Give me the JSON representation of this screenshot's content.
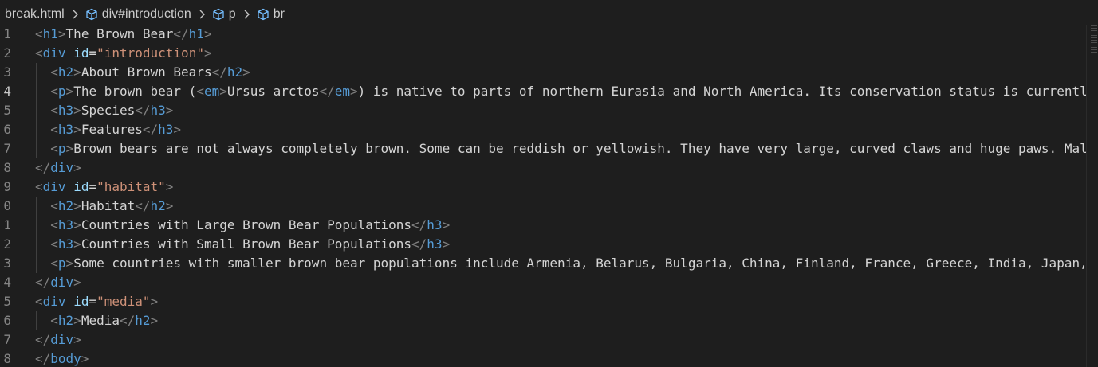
{
  "breadcrumb": {
    "file": "break.html",
    "items": [
      "div#introduction",
      "p",
      "br"
    ]
  },
  "editor": {
    "active_line": 4,
    "lines": [
      {
        "n": "1",
        "tokens": [
          [
            "t",
            "<"
          ],
          [
            "tag",
            "h1"
          ],
          [
            "t",
            ">"
          ],
          [
            "txt",
            "The Brown Bear"
          ],
          [
            "t",
            "</"
          ],
          [
            "tag",
            "h1"
          ],
          [
            "t",
            ">"
          ]
        ]
      },
      {
        "n": "2",
        "tokens": [
          [
            "t",
            "<"
          ],
          [
            "tag",
            "div"
          ],
          [
            "txt",
            " "
          ],
          [
            "attr",
            "id"
          ],
          [
            "txt",
            "="
          ],
          [
            "str",
            "\"introduction\""
          ],
          [
            "t",
            ">"
          ]
        ]
      },
      {
        "n": "3",
        "tokens": [
          [
            "txt",
            "  "
          ],
          [
            "t",
            "<"
          ],
          [
            "tag",
            "h2"
          ],
          [
            "t",
            ">"
          ],
          [
            "txt",
            "About Brown Bears"
          ],
          [
            "t",
            "</"
          ],
          [
            "tag",
            "h2"
          ],
          [
            "t",
            ">"
          ]
        ]
      },
      {
        "n": "4",
        "tokens": [
          [
            "txt",
            "  "
          ],
          [
            "t",
            "<"
          ],
          [
            "tag",
            "p"
          ],
          [
            "t",
            ">"
          ],
          [
            "txt",
            "The brown bear ("
          ],
          [
            "t",
            "<"
          ],
          [
            "tag",
            "em"
          ],
          [
            "t",
            ">"
          ],
          [
            "txt",
            "Ursus arctos"
          ],
          [
            "t",
            "</"
          ],
          [
            "tag",
            "em"
          ],
          [
            "t",
            ">"
          ],
          [
            "txt",
            ") is native to parts of northern Eurasia and North America. Its conservation status is currentl"
          ]
        ]
      },
      {
        "n": "5",
        "tokens": [
          [
            "txt",
            "  "
          ],
          [
            "t",
            "<"
          ],
          [
            "tag",
            "h3"
          ],
          [
            "t",
            ">"
          ],
          [
            "txt",
            "Species"
          ],
          [
            "t",
            "</"
          ],
          [
            "tag",
            "h3"
          ],
          [
            "t",
            ">"
          ]
        ]
      },
      {
        "n": "6",
        "tokens": [
          [
            "txt",
            "  "
          ],
          [
            "t",
            "<"
          ],
          [
            "tag",
            "h3"
          ],
          [
            "t",
            ">"
          ],
          [
            "txt",
            "Features"
          ],
          [
            "t",
            "</"
          ],
          [
            "tag",
            "h3"
          ],
          [
            "t",
            ">"
          ]
        ]
      },
      {
        "n": "7",
        "tokens": [
          [
            "txt",
            "  "
          ],
          [
            "t",
            "<"
          ],
          [
            "tag",
            "p"
          ],
          [
            "t",
            ">"
          ],
          [
            "txt",
            "Brown bears are not always completely brown. Some can be reddish or yellowish. They have very large, curved claws and huge paws. Mal"
          ]
        ]
      },
      {
        "n": "8",
        "tokens": [
          [
            "t",
            "</"
          ],
          [
            "tag",
            "div"
          ],
          [
            "t",
            ">"
          ]
        ]
      },
      {
        "n": "9",
        "tokens": [
          [
            "t",
            "<"
          ],
          [
            "tag",
            "div"
          ],
          [
            "txt",
            " "
          ],
          [
            "attr",
            "id"
          ],
          [
            "txt",
            "="
          ],
          [
            "str",
            "\"habitat\""
          ],
          [
            "t",
            ">"
          ]
        ]
      },
      {
        "n": "0",
        "tokens": [
          [
            "txt",
            "  "
          ],
          [
            "t",
            "<"
          ],
          [
            "tag",
            "h2"
          ],
          [
            "t",
            ">"
          ],
          [
            "txt",
            "Habitat"
          ],
          [
            "t",
            "</"
          ],
          [
            "tag",
            "h2"
          ],
          [
            "t",
            ">"
          ]
        ]
      },
      {
        "n": "1",
        "tokens": [
          [
            "txt",
            "  "
          ],
          [
            "t",
            "<"
          ],
          [
            "tag",
            "h3"
          ],
          [
            "t",
            ">"
          ],
          [
            "txt",
            "Countries with Large Brown Bear Populations"
          ],
          [
            "t",
            "</"
          ],
          [
            "tag",
            "h3"
          ],
          [
            "t",
            ">"
          ]
        ]
      },
      {
        "n": "2",
        "tokens": [
          [
            "txt",
            "  "
          ],
          [
            "t",
            "<"
          ],
          [
            "tag",
            "h3"
          ],
          [
            "t",
            ">"
          ],
          [
            "txt",
            "Countries with Small Brown Bear Populations"
          ],
          [
            "t",
            "</"
          ],
          [
            "tag",
            "h3"
          ],
          [
            "t",
            ">"
          ]
        ]
      },
      {
        "n": "3",
        "tokens": [
          [
            "txt",
            "  "
          ],
          [
            "t",
            "<"
          ],
          [
            "tag",
            "p"
          ],
          [
            "t",
            ">"
          ],
          [
            "txt",
            "Some countries with smaller brown bear populations include Armenia, Belarus, Bulgaria, China, Finland, France, Greece, India, Japan,"
          ]
        ]
      },
      {
        "n": "4",
        "tokens": [
          [
            "t",
            "</"
          ],
          [
            "tag",
            "div"
          ],
          [
            "t",
            ">"
          ]
        ]
      },
      {
        "n": "5",
        "tokens": [
          [
            "t",
            "<"
          ],
          [
            "tag",
            "div"
          ],
          [
            "txt",
            " "
          ],
          [
            "attr",
            "id"
          ],
          [
            "txt",
            "="
          ],
          [
            "str",
            "\"media\""
          ],
          [
            "t",
            ">"
          ]
        ]
      },
      {
        "n": "6",
        "tokens": [
          [
            "txt",
            "  "
          ],
          [
            "t",
            "<"
          ],
          [
            "tag",
            "h2"
          ],
          [
            "t",
            ">"
          ],
          [
            "txt",
            "Media"
          ],
          [
            "t",
            "</"
          ],
          [
            "tag",
            "h2"
          ],
          [
            "t",
            ">"
          ]
        ]
      },
      {
        "n": "7",
        "tokens": [
          [
            "t",
            "</"
          ],
          [
            "tag",
            "div"
          ],
          [
            "t",
            ">"
          ]
        ]
      },
      {
        "n": "8",
        "tokens": [
          [
            "t",
            "</"
          ],
          [
            "tag",
            "body"
          ],
          [
            "t",
            ">"
          ]
        ]
      }
    ]
  }
}
